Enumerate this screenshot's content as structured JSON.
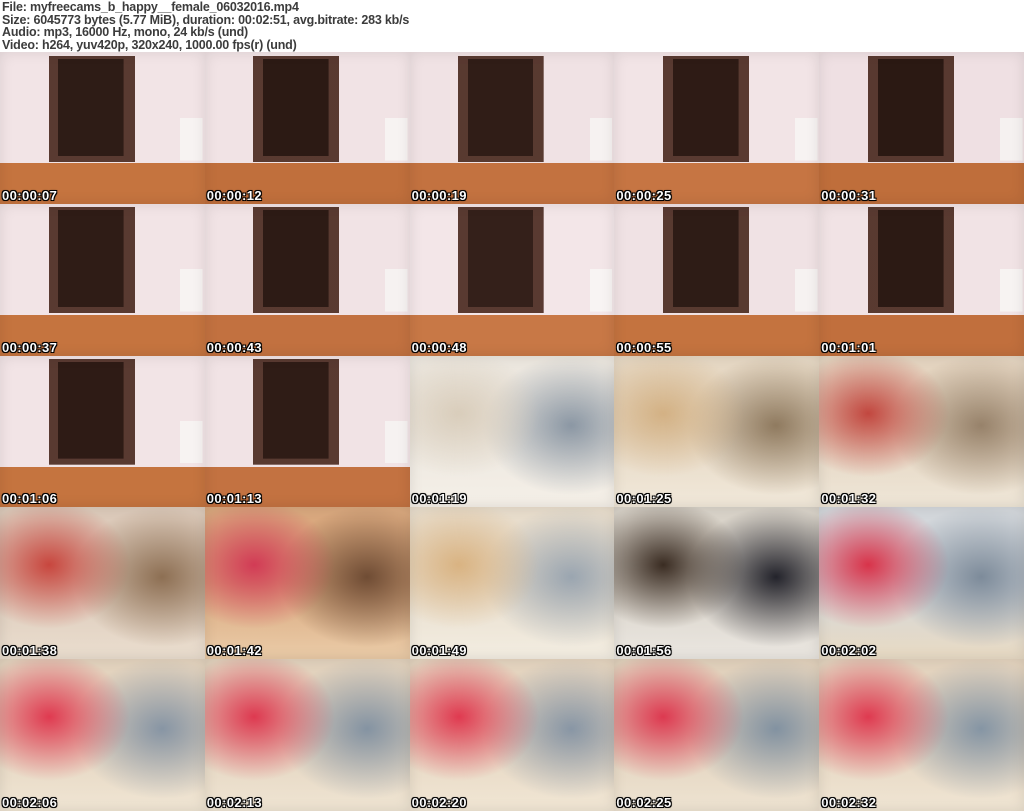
{
  "header": {
    "lines": [
      "File: myfreecams_b_happy__female_06032016.mp4",
      "Size: 6045773 bytes (5.77 MiB), duration: 00:02:51, avg.bitrate: 283 kb/s",
      "Audio: mp3, 16000 Hz, mono, 24 kb/s (und)",
      "Video: h264, yuv420p, 320x240, 1000.00 fps(r) (und)"
    ]
  },
  "grid": {
    "columns": 5,
    "rows": 5,
    "thumbnails": [
      {
        "timestamp": "00:00:07",
        "scene": "room",
        "palette": {
          "c1": "#f2e4e6",
          "c2": "#c5743f",
          "c3": "#2e1c16",
          "c4": "#f7f3f2"
        }
      },
      {
        "timestamp": "00:00:12",
        "scene": "room",
        "palette": {
          "c1": "#f1e3e5",
          "c2": "#c06f3c",
          "c3": "#2c1a14",
          "c4": "#f7f3f2"
        }
      },
      {
        "timestamp": "00:00:19",
        "scene": "room",
        "palette": {
          "c1": "#f0e2e4",
          "c2": "#c37240",
          "c3": "#301d17",
          "c4": "#f6f2f1"
        }
      },
      {
        "timestamp": "00:00:25",
        "scene": "room",
        "palette": {
          "c1": "#f2e4e6",
          "c2": "#c67543",
          "c3": "#2e1b15",
          "c4": "#f7f3f2"
        }
      },
      {
        "timestamp": "00:00:31",
        "scene": "room",
        "palette": {
          "c1": "#efe0e3",
          "c2": "#bf6e3b",
          "c3": "#2b1913",
          "c4": "#f5f1f0"
        }
      },
      {
        "timestamp": "00:00:37",
        "scene": "room",
        "palette": {
          "c1": "#f2e4e6",
          "c2": "#c5743f",
          "c3": "#2f1c16",
          "c4": "#f7f3f2"
        }
      },
      {
        "timestamp": "00:00:43",
        "scene": "room",
        "palette": {
          "c1": "#f1e3e5",
          "c2": "#c27140",
          "c3": "#2d1b15",
          "c4": "#f6f2f1"
        }
      },
      {
        "timestamp": "00:00:48",
        "scene": "room",
        "palette": {
          "c1": "#f3e6e8",
          "c2": "#c87846",
          "c3": "#34201a",
          "c4": "#f8f4f3"
        }
      },
      {
        "timestamp": "00:00:55",
        "scene": "room",
        "palette": {
          "c1": "#f0e2e4",
          "c2": "#c4733f",
          "c3": "#2e1c16",
          "c4": "#f6f2f1"
        }
      },
      {
        "timestamp": "00:01:01",
        "scene": "room",
        "palette": {
          "c1": "#f1e3e5",
          "c2": "#c16f3d",
          "c3": "#2c1a14",
          "c4": "#f7f3f2"
        }
      },
      {
        "timestamp": "00:01:06",
        "scene": "room",
        "palette": {
          "c1": "#f2e4e6",
          "c2": "#c5743f",
          "c3": "#2e1b15",
          "c4": "#f7f3f2"
        }
      },
      {
        "timestamp": "00:01:13",
        "scene": "room",
        "palette": {
          "c1": "#f1e3e5",
          "c2": "#c37241",
          "c3": "#2f1c16",
          "c4": "#f6f2f1"
        }
      },
      {
        "timestamp": "00:01:19",
        "scene": "abstract",
        "palette": {
          "c1": "#ece7df",
          "c2": "#f4efe7",
          "c3": "#d9cdbb",
          "c4": "#8b97a4"
        }
      },
      {
        "timestamp": "00:01:25",
        "scene": "abstract",
        "palette": {
          "c1": "#e6d8c4",
          "c2": "#f0e7d8",
          "c3": "#d3b184",
          "c4": "#8f7a5f"
        }
      },
      {
        "timestamp": "00:01:32",
        "scene": "abstract",
        "palette": {
          "c1": "#e4d4c0",
          "c2": "#eee5d6",
          "c3": "#c2473f",
          "c4": "#97826a"
        }
      },
      {
        "timestamp": "00:01:38",
        "scene": "abstract",
        "palette": {
          "c1": "#dccaba",
          "c2": "#e9dccd",
          "c3": "#c8463e",
          "c4": "#8d6f53"
        }
      },
      {
        "timestamp": "00:01:42",
        "scene": "abstract",
        "palette": {
          "c1": "#d9a87e",
          "c2": "#e9c9a5",
          "c3": "#d23b55",
          "c4": "#6f4c34"
        }
      },
      {
        "timestamp": "00:01:49",
        "scene": "abstract",
        "palette": {
          "c1": "#e8ddcc",
          "c2": "#f2ece0",
          "c3": "#d9b382",
          "c4": "#9aa5b0"
        }
      },
      {
        "timestamp": "00:01:56",
        "scene": "abstract",
        "palette": {
          "c1": "#d9d3c9",
          "c2": "#e9e5df",
          "c3": "#3a2c22",
          "c4": "#23232b"
        }
      },
      {
        "timestamp": "00:02:02",
        "scene": "abstract",
        "palette": {
          "c1": "#d3d7db",
          "c2": "#e7dac5",
          "c3": "#d8334a",
          "c4": "#7d8b9a"
        }
      },
      {
        "timestamp": "00:02:06",
        "scene": "abstract",
        "palette": {
          "c1": "#e3d3be",
          "c2": "#efe4d2",
          "c3": "#e03a50",
          "c4": "#8795a4"
        }
      },
      {
        "timestamp": "00:02:13",
        "scene": "abstract",
        "palette": {
          "c1": "#e2d2bd",
          "c2": "#eee3d1",
          "c3": "#de3950",
          "c4": "#8493a2"
        }
      },
      {
        "timestamp": "00:02:20",
        "scene": "abstract",
        "palette": {
          "c1": "#e4d4bf",
          "c2": "#f0e5d3",
          "c3": "#e03a50",
          "c4": "#8896a5"
        }
      },
      {
        "timestamp": "00:02:25",
        "scene": "abstract",
        "palette": {
          "c1": "#e1d1bc",
          "c2": "#ede2d0",
          "c3": "#dd3950",
          "c4": "#8292a1"
        }
      },
      {
        "timestamp": "00:02:32",
        "scene": "abstract",
        "palette": {
          "c1": "#e3d3be",
          "c2": "#efe4d2",
          "c3": "#df3a50",
          "c4": "#8595a4"
        }
      }
    ]
  },
  "colors": {
    "background": "#ffffff",
    "header_text": "#3c3c3c",
    "timestamp_text": "#ffffff",
    "timestamp_outline": "#000000",
    "wall_pink": "#f2e4e6",
    "wood_floor": "#c5743f",
    "doorway_dark": "#2e1c16",
    "heart_pillow_red": "#e03a50",
    "couch_gray": "#8795a4"
  }
}
